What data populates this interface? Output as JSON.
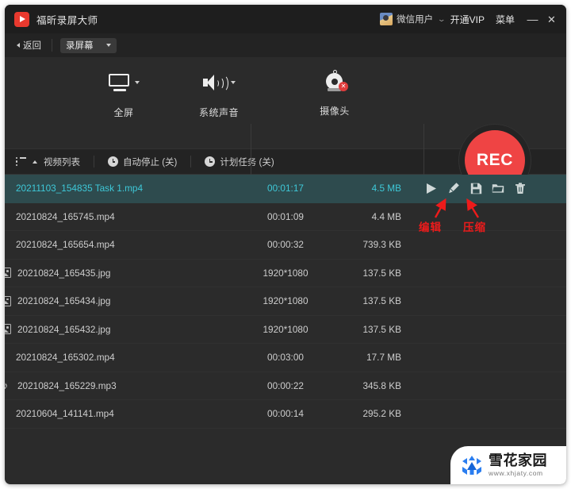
{
  "window": {
    "app_name": "福昕录屏大师",
    "logo_icon": "play-logo-icon",
    "user_name": "微信用户",
    "user_caret": "⌄",
    "vip_label": "开通VIP",
    "menu_label": "菜单",
    "minimize_label": "—",
    "close_label": "✕"
  },
  "toolbar": {
    "back_label": "返回",
    "mode_select_value": "录屏幕"
  },
  "capture": {
    "modes": [
      {
        "label": "全屏",
        "icon": "monitor-icon",
        "has_dropdown": true
      },
      {
        "label": "系统声音",
        "icon": "speaker-icon",
        "has_dropdown": true
      },
      {
        "label": "摄像头",
        "icon": "webcam-icon",
        "has_dropdown": false,
        "badge": "✕"
      }
    ],
    "record_button_label": "REC",
    "record_button_color": "#ef4444"
  },
  "subtoolbar": {
    "video_list_label": "视频列表",
    "auto_stop_label": "自动停止 (关)",
    "scheduled_task_label": "计划任务 (关)"
  },
  "filelist": {
    "row_actions": [
      {
        "name": "play-icon",
        "title": "播放"
      },
      {
        "name": "edit-brush-icon",
        "title": "编辑"
      },
      {
        "name": "compress-save-icon",
        "title": "压缩"
      },
      {
        "name": "folder-icon",
        "title": "打开文件夹"
      },
      {
        "name": "trash-icon",
        "title": "删除"
      }
    ],
    "selected_row_bg": "#2e4b4e",
    "selected_text_color": "#3ec8d8",
    "rows": [
      {
        "name": "20211103_154835 Task 1.mp4",
        "duration": "00:01:17",
        "size": "4.5 MB",
        "icon": "",
        "selected": true
      },
      {
        "name": "20210824_165745.mp4",
        "duration": "00:01:09",
        "size": "4.4 MB",
        "icon": "",
        "selected": false
      },
      {
        "name": "20210824_165654.mp4",
        "duration": "00:00:32",
        "size": "739.3 KB",
        "icon": "",
        "selected": false
      },
      {
        "name": "20210824_165435.jpg",
        "duration": "1920*1080",
        "size": "137.5 KB",
        "icon": "image-icon",
        "selected": false
      },
      {
        "name": "20210824_165434.jpg",
        "duration": "1920*1080",
        "size": "137.5 KB",
        "icon": "image-icon",
        "selected": false
      },
      {
        "name": "20210824_165432.jpg",
        "duration": "1920*1080",
        "size": "137.5 KB",
        "icon": "image-icon",
        "selected": false
      },
      {
        "name": "20210824_165302.mp4",
        "duration": "00:03:00",
        "size": "17.7 MB",
        "icon": "",
        "selected": false
      },
      {
        "name": "20210824_165229.mp3",
        "duration": "00:00:22",
        "size": "345.8 KB",
        "icon": "music-icon",
        "selected": false
      },
      {
        "name": "20210604_141141.mp4",
        "duration": "00:00:14",
        "size": "295.2 KB",
        "icon": "",
        "selected": false
      }
    ]
  },
  "annotations": {
    "color": "#ee1b1b",
    "items": [
      {
        "label": "编辑",
        "target": "edit-brush-icon"
      },
      {
        "label": "压缩",
        "target": "compress-save-icon"
      }
    ]
  },
  "watermark": {
    "brand_cn": "雪花家园",
    "url": "www.xhjaty.com",
    "mark_color": "#2b7ef0"
  }
}
